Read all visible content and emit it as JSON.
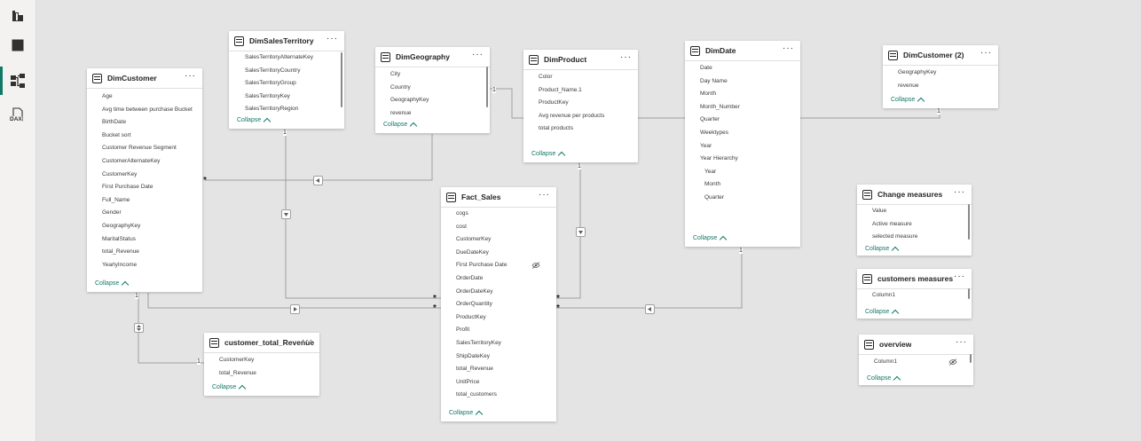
{
  "rail": {
    "items": [
      {
        "name": "report-view",
        "icon": "report-icon",
        "active": false
      },
      {
        "name": "table-view",
        "icon": "table-icon",
        "active": false
      },
      {
        "name": "model-view",
        "icon": "model-icon",
        "active": true
      },
      {
        "name": "dax-query-view",
        "icon": "dax-icon",
        "label": "DAX",
        "active": false
      }
    ]
  },
  "tables": {
    "dimcustomer": {
      "title": "DimCustomer",
      "fields": [
        "Age",
        "Avg time between purchase Bucket",
        "BirthDate",
        "Bucket sort",
        "Customer Revenue Segment",
        "CustomerAlternateKey",
        "CustomerKey",
        "First Purchase Date",
        "Full_Name",
        "Gender",
        "GeographyKey",
        "MaritalStatus",
        "total_Revenue",
        "YearlyIncome"
      ],
      "collapse": "Collapse"
    },
    "dimsalesterritory": {
      "title": "DimSalesTerritory",
      "fields": [
        "SalesTerritoryAlternateKey",
        "SalesTerritoryCountry",
        "SalesTerritoryGroup",
        "SalesTerritoryKey",
        "SalesTerritoryRegion"
      ],
      "collapse": "Collapse"
    },
    "dimgeography": {
      "title": "DimGeography",
      "fields": [
        "City",
        "Country",
        "GeographyKey",
        "revenue"
      ],
      "collapse": "Collapse"
    },
    "dimproduct": {
      "title": "DimProduct",
      "fields": [
        "Color",
        "Product_Name.1",
        "ProductKey",
        "Avg revenue per products",
        "total products"
      ],
      "collapse": "Collapse"
    },
    "dimdate": {
      "title": "DimDate",
      "fields": [
        "Date",
        "Day Name",
        "Month",
        "Month_Number",
        "Quarter",
        "Weektypes",
        "Year",
        "Year Hierarchy"
      ],
      "hierarchy": [
        "Year",
        "Month",
        "Quarter"
      ],
      "collapse": "Collapse"
    },
    "dimcustomer2": {
      "title": "DimCustomer (2)",
      "fields": [
        "GeographyKey",
        "revenue"
      ],
      "collapse": "Collapse"
    },
    "fact_sales": {
      "title": "Fact_Sales",
      "fields": [
        "cogs",
        "cost",
        "CustomerKey",
        "DueDateKey",
        "First Purchase Date",
        "OrderDate",
        "OrderDateKey",
        "OrderQuantity",
        "ProductKey",
        "Profit",
        "SalesTerritoryKey",
        "ShipDateKey",
        "total_Revenue",
        "UnitPrice",
        "total_customers"
      ],
      "hidden_field": "First Purchase Date",
      "collapse": "Collapse"
    },
    "customer_total_revenue": {
      "title": "customer_total_Revenue",
      "fields": [
        "CustomerKey",
        "total_Revenue"
      ],
      "collapse": "Collapse"
    },
    "change_measures": {
      "title": "Change measures",
      "fields": [
        "Value",
        "Active measure",
        "selected measure"
      ],
      "collapse": "Collapse"
    },
    "customers_measures": {
      "title": "customers measures",
      "fields": [
        "Column1"
      ],
      "collapse": "Collapse"
    },
    "overview": {
      "title": "overview",
      "fields": [
        "Column1"
      ],
      "hidden_field": "Column1",
      "collapse": "Collapse"
    }
  },
  "cardinality": {
    "one": "1",
    "many": "*"
  },
  "more_label": "···",
  "colors": {
    "accent": "#117865",
    "line": "#a19f9d",
    "canvas": "#e4e4e4"
  }
}
